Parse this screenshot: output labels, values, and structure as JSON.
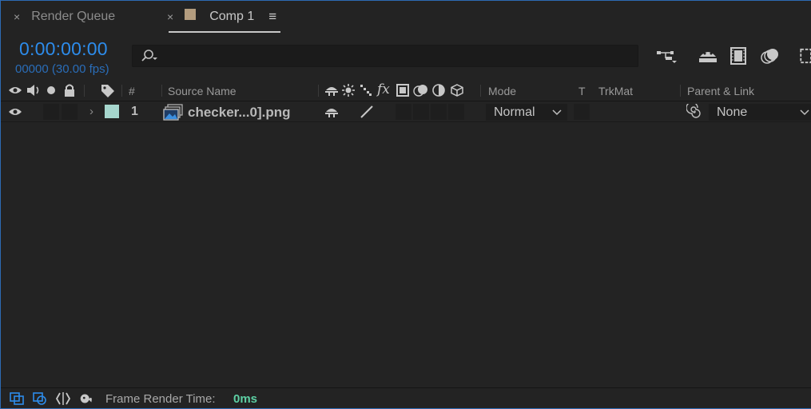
{
  "tabs": [
    {
      "close": "×",
      "label": "Render Queue",
      "active": false
    },
    {
      "close": "×",
      "label": "Comp 1",
      "active": true,
      "swatch_color": "#b39c7e",
      "menu": "≡"
    }
  ],
  "time": {
    "timecode": "0:00:00:00",
    "frames": "00000 (30.00 fps)"
  },
  "search": {
    "value": "",
    "placeholder": ""
  },
  "toolbar": [
    "composition-mini-flowchart-icon",
    "shy-layers-icon",
    "frame-blending-icon",
    "motion-blur-icon",
    "graph-editor-icon"
  ],
  "columns": {
    "num": "#",
    "source_name": "Source Name",
    "mode": "Mode",
    "t": "T",
    "trkmat": "TrkMat",
    "parent": "Parent & Link"
  },
  "layer": {
    "number": "1",
    "name": "checker...0].png",
    "label_color": "#a6d6cd",
    "mode": "Normal",
    "parent": "None"
  },
  "footer": {
    "label": "Frame Render Time:",
    "value": "0ms"
  },
  "colors": {
    "accent_blue": "#2d8ceb",
    "render_time_green": "#5dd0a4",
    "panel_bg": "#232323"
  }
}
